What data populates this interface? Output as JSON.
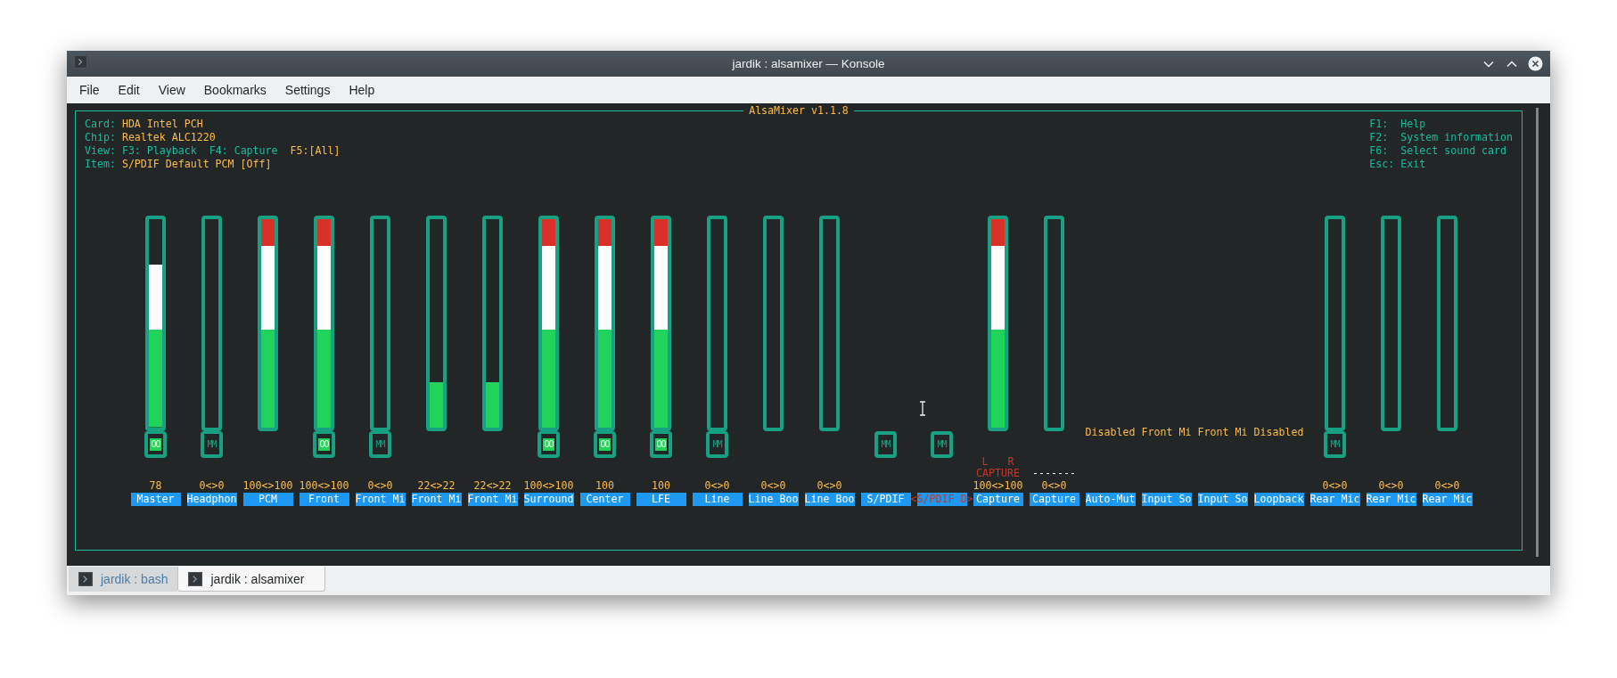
{
  "window": {
    "title": "jardik : alsamixer — Konsole"
  },
  "menu": [
    "File",
    "Edit",
    "View",
    "Bookmarks",
    "Settings",
    "Help"
  ],
  "mixer": {
    "title": "AlsaMixer v1.1.8",
    "info": [
      {
        "label": "Card:",
        "value": "HDA Intel PCH"
      },
      {
        "label": "Chip:",
        "value": "Realtek ALC1220"
      },
      {
        "label": "View:",
        "options": [
          {
            "key": "F3:",
            "name": "Playback",
            "selected": false
          },
          {
            "key": "F4:",
            "name": "Capture",
            "selected": false
          },
          {
            "key": "F5:",
            "name": "[All]",
            "selected": true
          }
        ]
      },
      {
        "label": "Item:",
        "value": "S/PDIF Default PCM [Off]"
      }
    ],
    "help": [
      {
        "key": "F1:",
        "text": "Help"
      },
      {
        "key": "F2:",
        "text": "System information"
      },
      {
        "key": "F6:",
        "text": "Select sound card"
      },
      {
        "key": "Esc:",
        "text": "Exit"
      }
    ],
    "selection_marks": {
      "left": "<",
      "right": ">"
    },
    "channels": [
      {
        "name": "Master",
        "kind": "fader",
        "value": "78",
        "level": 0.78,
        "switch": {
          "text": "OO",
          "muted": false
        },
        "selected": false
      },
      {
        "name": "Headphon",
        "kind": "fader",
        "value": "0<>0",
        "level": 0,
        "switch": {
          "text": "MM",
          "muted": true
        },
        "selected": false
      },
      {
        "name": "PCM",
        "kind": "fader",
        "value": "100<>100",
        "level": 1,
        "selected": false
      },
      {
        "name": "Front",
        "kind": "fader",
        "value": "100<>100",
        "level": 1,
        "switch": {
          "text": "OO",
          "muted": false
        },
        "selected": false
      },
      {
        "name": "Front Mi",
        "kind": "fader",
        "value": "0<>0",
        "level": 0,
        "switch": {
          "text": "MM",
          "muted": true
        },
        "selected": false
      },
      {
        "name": "Front Mi",
        "kind": "fader",
        "value": "22<>22",
        "level": 0.22,
        "selected": false
      },
      {
        "name": "Front Mi",
        "kind": "fader",
        "value": "22<>22",
        "level": 0.22,
        "selected": false
      },
      {
        "name": "Surround",
        "kind": "fader",
        "value": "100<>100",
        "level": 1,
        "switch": {
          "text": "OO",
          "muted": false
        },
        "selected": false
      },
      {
        "name": "Center",
        "kind": "fader",
        "value": "100",
        "level": 1,
        "switch": {
          "text": "OO",
          "muted": false
        },
        "selected": false
      },
      {
        "name": "LFE",
        "kind": "fader",
        "value": "100",
        "level": 1,
        "switch": {
          "text": "OO",
          "muted": false
        },
        "selected": false
      },
      {
        "name": "Line",
        "kind": "fader",
        "value": "0<>0",
        "level": 0,
        "switch": {
          "text": "MM",
          "muted": true
        },
        "selected": false
      },
      {
        "name": "Line Boo",
        "kind": "fader",
        "value": "0<>0",
        "level": 0,
        "selected": false
      },
      {
        "name": "Line Boo",
        "kind": "fader",
        "value": "0<>0",
        "level": 0,
        "selected": false
      },
      {
        "name": "S/PDIF",
        "kind": "switch",
        "switch": {
          "text": "MM",
          "muted": true
        },
        "selected": false
      },
      {
        "name": "S/PDIF D",
        "kind": "switch",
        "switch": {
          "text": "MM",
          "muted": true
        },
        "selected": true
      },
      {
        "name": "Capture",
        "kind": "fader",
        "value": "100<>100",
        "level": 1,
        "capture": {
          "on": true,
          "left": "L",
          "right": "R",
          "label": "CAPTURE"
        },
        "selected": false
      },
      {
        "name": "Capture",
        "kind": "fader",
        "value": "0<>0",
        "level": 0,
        "capture": {
          "on": false,
          "label": "-------"
        },
        "selected": false
      },
      {
        "name": "Auto-Mut",
        "kind": "enum",
        "enum_value": "Disabled",
        "selected": false
      },
      {
        "name": "Input So",
        "kind": "enum",
        "enum_value": "Front Mi",
        "selected": false
      },
      {
        "name": "Input So",
        "kind": "enum",
        "enum_value": "Front Mi",
        "selected": false
      },
      {
        "name": "Loopback",
        "kind": "enum",
        "enum_value": "Disabled",
        "selected": false
      },
      {
        "name": "Rear Mic",
        "kind": "fader",
        "value": "0<>0",
        "level": 0,
        "switch": {
          "text": "MM",
          "muted": true
        },
        "selected": false
      },
      {
        "name": "Rear Mic",
        "kind": "fader",
        "value": "0<>0",
        "level": 0,
        "selected": false
      },
      {
        "name": "Rear Mic",
        "kind": "fader",
        "value": "0<>0",
        "level": 0,
        "selected": false
      }
    ]
  },
  "tabs": [
    {
      "label": "jardik : bash",
      "selected": false
    },
    {
      "label": "jardik : alsamixer",
      "selected": true
    }
  ]
}
